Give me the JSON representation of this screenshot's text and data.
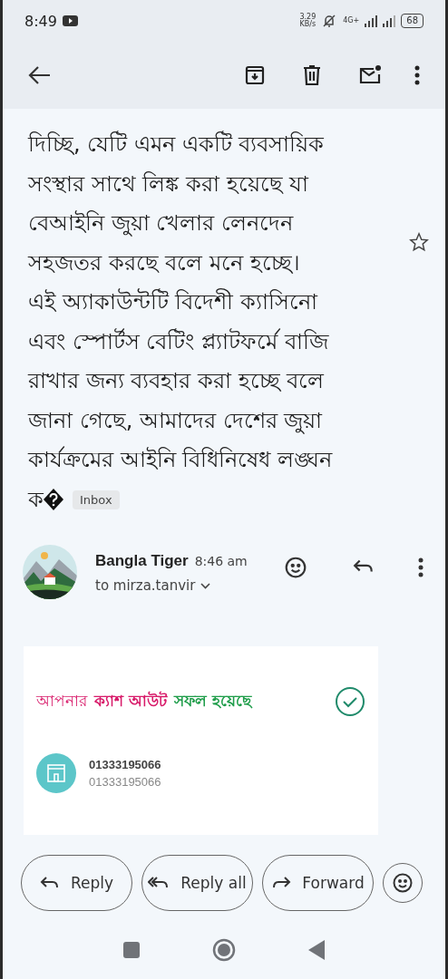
{
  "status_bar": {
    "time": "8:49",
    "speed": "3.29",
    "speed_unit": "KB/s",
    "network": "4G+",
    "battery": "68"
  },
  "body_lines": [
    "দিচ্ছি, যেটি এমন একটি ব্যবসায়িক",
    "সংস্থার সাথে লিঙ্ক করা হয়েছে যা",
    "বেআইনি জুয়া খেলার লেনদেন",
    "সহজতর করছে বলে মনে হচ্ছে।",
    "এই অ্যাকাউন্টটি বিদেশী ক্যাসিনো",
    "এবং স্পোর্টস বেটিং প্ল্যাটফর্মে বাজি",
    "রাখার জন্য ব্যবহার করা হচ্ছে বলে",
    "জানা গেছে, আমাদের দেশের জুয়া",
    "কার্যক্রমের আইনি বিধিনিষেধ লঙ্ঘন"
  ],
  "last_line": "ক",
  "label": "Inbox",
  "starred": false,
  "sender": {
    "name": "Bangla Tiger",
    "time": "8:46 am",
    "to": "to mirza.tanvir"
  },
  "card": {
    "title_parts": [
      {
        "text": "আপনার",
        "color": "#d81b6a",
        "bold": false
      },
      {
        "text": "ক্যাশ আউট",
        "color": "#d81b6a",
        "bold": true
      },
      {
        "text": "সফল হয়েছে",
        "color": "#1f9d4a",
        "bold": true
      }
    ],
    "number": "01333195066",
    "number_sub": "01333195066"
  },
  "actions": [
    {
      "label": "Reply",
      "kind": "reply"
    },
    {
      "label": "Reply all",
      "kind": "reply_all"
    },
    {
      "label": "Forward",
      "kind": "forward"
    }
  ]
}
